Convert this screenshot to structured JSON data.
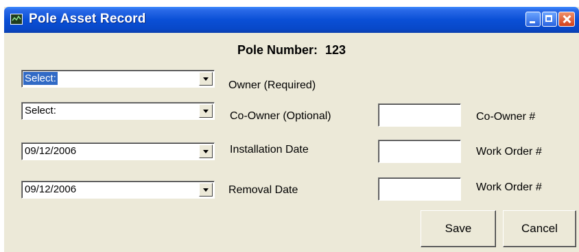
{
  "window": {
    "title": "Pole Asset Record",
    "icon": "app-chart-icon",
    "controls": {
      "minimize": "minimize-icon",
      "maximize": "maximize-icon",
      "close": "close-icon"
    }
  },
  "header": {
    "label": "Pole Number:",
    "value": "123"
  },
  "rows": [
    {
      "combo_value": "Select:",
      "combo_selected": true,
      "label": "Owner (Required)"
    },
    {
      "combo_value": "Select:",
      "label": "Co-Owner (Optional)",
      "field_label": "Co-Owner #",
      "field_value": ""
    },
    {
      "combo_value": "09/12/2006",
      "label": "Installation Date",
      "field_label": "Work Order #",
      "field_value": ""
    },
    {
      "combo_value": "09/12/2006",
      "label": "Removal Date",
      "field_label": "Work Order #",
      "field_value": ""
    }
  ],
  "buttons": {
    "save": "Save",
    "cancel": "Cancel"
  },
  "colors": {
    "titlebar": "#0A4FD6",
    "dialog_bg": "#ECE9D8",
    "selection": "#316AC5"
  }
}
